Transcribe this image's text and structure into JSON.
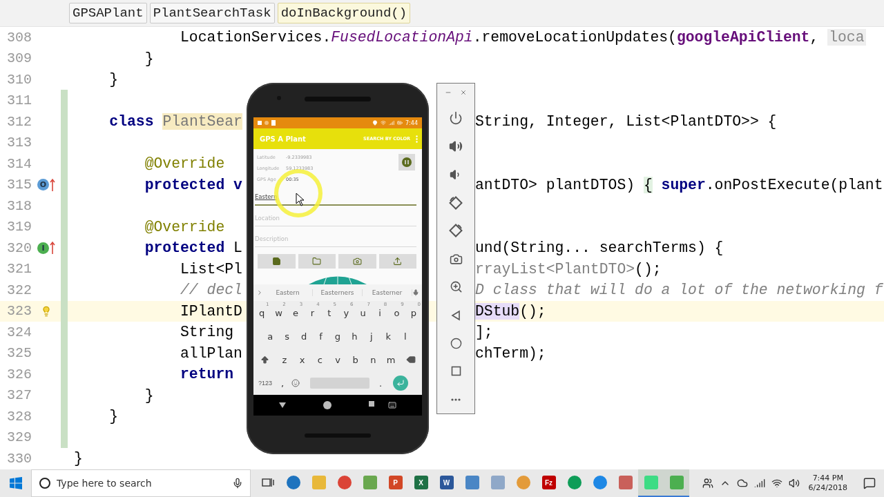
{
  "editor": {
    "breadcrumbs": [
      {
        "label": "GPSAPlant",
        "selected": false
      },
      {
        "label": "PlantSearchTask",
        "selected": false
      },
      {
        "label": "doInBackground()",
        "selected": true
      }
    ],
    "lines": [
      {
        "number": "308",
        "current": false,
        "changed": false,
        "text": [
          {
            "text": "            LocationServices.",
            "kind": "plain"
          },
          {
            "text": "FusedLocationApi",
            "kind": "static"
          },
          {
            "text": ".removeLocationUpdates(",
            "kind": "plain"
          },
          {
            "text": "googleApiClient",
            "kind": "field"
          },
          {
            "text": ", ",
            "kind": "plain"
          },
          {
            "text": "loca",
            "kind": "hint"
          }
        ]
      },
      {
        "number": "309",
        "current": false,
        "changed": false,
        "text": [
          {
            "text": "        }",
            "kind": "plain"
          }
        ]
      },
      {
        "number": "310",
        "current": false,
        "changed": false,
        "text": [
          {
            "text": "    }",
            "kind": "plain"
          }
        ]
      },
      {
        "number": "311",
        "current": false,
        "changed": true
      },
      {
        "number": "312",
        "current": false,
        "changed": true,
        "left": [
          {
            "text": "    class ",
            "kind": "keyword"
          },
          {
            "text": "PlantSear",
            "kind": "match"
          }
        ],
        "right": [
          {
            "text": "String, Integer, List<PlantDTO>> {",
            "kind": "plain"
          }
        ]
      },
      {
        "number": "313",
        "current": false,
        "changed": true
      },
      {
        "number": "314",
        "current": false,
        "changed": true,
        "text": [
          {
            "text": "        @Override",
            "kind": "annotation"
          }
        ]
      },
      {
        "number": "315",
        "current": false,
        "changed": true,
        "marker": {
          "kind": "override",
          "letter": "O",
          "color": "#5b9bd5"
        },
        "left": [
          {
            "text": "        protected v",
            "kind": "keyword"
          }
        ],
        "right": [
          {
            "text": "antDTO> plantDTOS) ",
            "kind": "plain"
          },
          {
            "text": "{",
            "kind": "brace"
          },
          {
            "text": " super",
            "kind": "keyword"
          },
          {
            "text": ".onPostExecute(plant",
            "kind": "plain"
          }
        ]
      },
      {
        "number": "318",
        "current": false,
        "changed": true
      },
      {
        "number": "319",
        "current": false,
        "changed": true,
        "text": [
          {
            "text": "        @Override",
            "kind": "annotation"
          }
        ]
      },
      {
        "number": "320",
        "current": false,
        "changed": true,
        "marker": {
          "kind": "override",
          "letter": "I",
          "color": "#4caf50"
        },
        "left": [
          {
            "text": "        protected",
            "kind": "keyword"
          },
          {
            "text": " L",
            "kind": "plain"
          }
        ],
        "right": [
          {
            "text": "und(String... searchTerms) {",
            "kind": "plain"
          }
        ]
      },
      {
        "number": "321",
        "current": false,
        "changed": true,
        "left": [
          {
            "text": "            List<Pl",
            "kind": "plain"
          }
        ],
        "right": [
          {
            "text": "rrayList<PlantDTO>",
            "kind": "muted"
          },
          {
            "text": "();",
            "kind": "plain"
          }
        ]
      },
      {
        "number": "322",
        "current": false,
        "changed": true,
        "left": [
          {
            "text": "            // decl",
            "kind": "comment"
          }
        ],
        "right": [
          {
            "text": "D class that will do a lot of the networking f",
            "kind": "comment"
          }
        ]
      },
      {
        "number": "323",
        "current": true,
        "changed": true,
        "marker": {
          "kind": "bulb"
        },
        "left": [
          {
            "text": "            IPlantD",
            "kind": "plain"
          }
        ],
        "right": [
          {
            "text": "DStub",
            "kind": "selected"
          },
          {
            "text": "();",
            "kind": "plain"
          }
        ]
      },
      {
        "number": "324",
        "current": false,
        "changed": true,
        "left": [
          {
            "text": "            String",
            "kind": "plain"
          }
        ],
        "right": [
          {
            "text": "];",
            "kind": "plain"
          }
        ]
      },
      {
        "number": "325",
        "current": false,
        "changed": true,
        "left": [
          {
            "text": "            allPlan",
            "kind": "plain"
          }
        ],
        "right": [
          {
            "text": "chTerm);",
            "kind": "plain"
          }
        ]
      },
      {
        "number": "326",
        "current": false,
        "changed": true,
        "text": [
          {
            "text": "            return",
            "kind": "keyword"
          }
        ]
      },
      {
        "number": "327",
        "current": false,
        "changed": true,
        "text": [
          {
            "text": "        }",
            "kind": "plain"
          }
        ]
      },
      {
        "number": "328",
        "current": false,
        "changed": true,
        "text": [
          {
            "text": "    }",
            "kind": "plain"
          }
        ]
      },
      {
        "number": "329",
        "current": false,
        "changed": true
      },
      {
        "number": "330",
        "current": false,
        "changed": false,
        "text": [
          {
            "text": "}",
            "kind": "plain"
          }
        ]
      }
    ]
  },
  "phone": {
    "time": "7:44",
    "title": "GPS A Plant",
    "menu_action": "SEARCH BY COLOR",
    "readings": [
      {
        "label": "Latitude",
        "value": "-9.2339983"
      },
      {
        "label": "Longitude",
        "value": "59.1233983"
      },
      {
        "label": "GPS Age",
        "value": "00:35"
      }
    ],
    "fields": [
      {
        "value": "Eastern",
        "focused": true
      },
      {
        "placeholder": "Location",
        "focused": false
      },
      {
        "placeholder": "Description",
        "focused": false
      }
    ],
    "actions": [
      {
        "kind": "save"
      },
      {
        "kind": "folder"
      },
      {
        "kind": "camera"
      },
      {
        "kind": "upload"
      }
    ],
    "keyboard": {
      "suggestions": [
        "Eastern",
        "Easterners",
        "Easterner"
      ],
      "rows": [
        [
          {
            "key": "q",
            "hint": "1"
          },
          {
            "key": "w",
            "hint": "2"
          },
          {
            "key": "e",
            "hint": "3"
          },
          {
            "key": "r",
            "hint": "4"
          },
          {
            "key": "t",
            "hint": "5"
          },
          {
            "key": "y",
            "hint": "6"
          },
          {
            "key": "u",
            "hint": "7"
          },
          {
            "key": "i",
            "hint": "8"
          },
          {
            "key": "o",
            "hint": "9"
          },
          {
            "key": "p",
            "hint": "0"
          }
        ],
        [
          {
            "key": "a"
          },
          {
            "key": "s"
          },
          {
            "key": "d"
          },
          {
            "key": "f"
          },
          {
            "key": "g"
          },
          {
            "key": "h"
          },
          {
            "key": "j"
          },
          {
            "key": "k"
          },
          {
            "key": "l"
          }
        ],
        [
          {
            "key": "z"
          },
          {
            "key": "x"
          },
          {
            "key": "c"
          },
          {
            "key": "v"
          },
          {
            "key": "b"
          },
          {
            "key": "n"
          },
          {
            "key": "m"
          }
        ]
      ],
      "symbols_key": "?123",
      "comma_key": ",",
      "period_key": "."
    }
  },
  "emulator_toolbar": {
    "buttons": [
      {
        "kind": "power"
      },
      {
        "kind": "volume-up"
      },
      {
        "kind": "volume-down"
      },
      {
        "kind": "rotate-left"
      },
      {
        "kind": "rotate-right"
      },
      {
        "kind": "camera"
      },
      {
        "kind": "zoom"
      },
      {
        "kind": "back"
      },
      {
        "kind": "home"
      },
      {
        "kind": "overview"
      },
      {
        "kind": "more"
      }
    ]
  },
  "taskbar": {
    "search_placeholder": "Type here to search",
    "apps": [
      {
        "kind": "taskview",
        "active": false
      },
      {
        "kind": "circle",
        "color": "#1e73be",
        "active": false
      },
      {
        "kind": "tile",
        "color": "#e8b83a",
        "active": false
      },
      {
        "kind": "circle",
        "color": "#db4437",
        "active": false
      },
      {
        "kind": "tile",
        "color": "#6aa84f",
        "active": false
      },
      {
        "kind": "tile",
        "color": "#d24726",
        "label": "P",
        "active": false
      },
      {
        "kind": "tile",
        "color": "#1e7145",
        "label": "X",
        "active": false
      },
      {
        "kind": "tile",
        "color": "#2b579a",
        "label": "W",
        "active": false
      },
      {
        "kind": "tile",
        "color": "#4a86c5",
        "active": false
      },
      {
        "kind": "tile",
        "color": "#8fa8c8",
        "active": false
      },
      {
        "kind": "circle",
        "color": "#e39b3a",
        "active": false
      },
      {
        "kind": "tile",
        "color": "#bf0000",
        "label": "Fz",
        "active": false
      },
      {
        "kind": "circle",
        "color": "#0f9d58",
        "active": false
      },
      {
        "kind": "circle",
        "color": "#1e88e5",
        "active": false
      },
      {
        "kind": "tile",
        "color": "#c9605a",
        "active": false
      },
      {
        "kind": "tile",
        "color": "#3ddc84",
        "active": true
      },
      {
        "kind": "tile",
        "color": "#4caf50",
        "active": true
      }
    ],
    "time": "7:44 PM",
    "date": "6/24/2018"
  }
}
